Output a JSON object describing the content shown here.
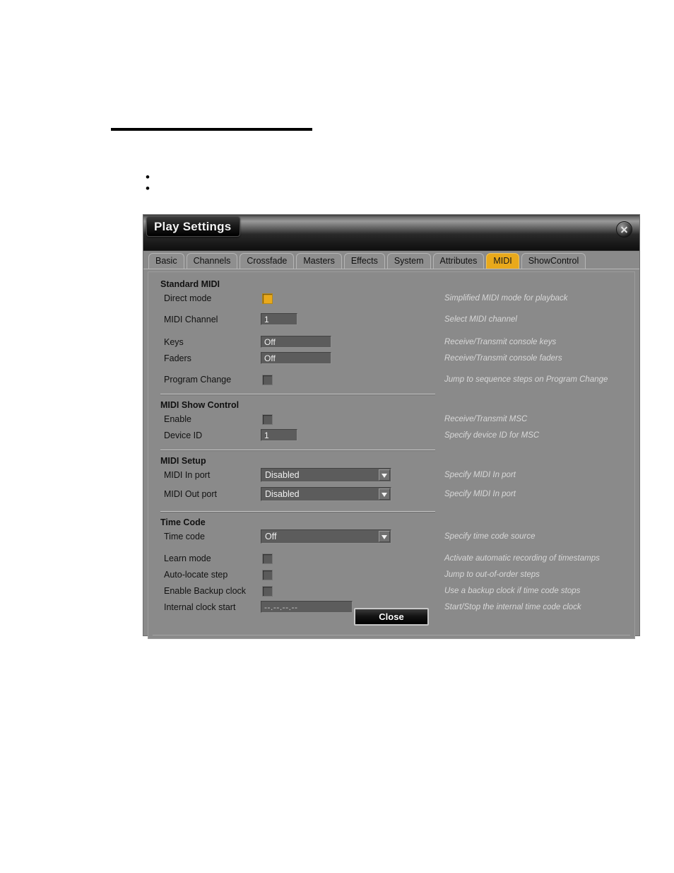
{
  "document": {
    "bullets": [
      "•",
      "•"
    ]
  },
  "dialog": {
    "title": "Play Settings",
    "close_icon": "close-circle-icon",
    "tabs": [
      {
        "label": "Basic",
        "active": false
      },
      {
        "label": "Channels",
        "active": false
      },
      {
        "label": "Crossfade",
        "active": false
      },
      {
        "label": "Masters",
        "active": false
      },
      {
        "label": "Effects",
        "active": false
      },
      {
        "label": "System",
        "active": false
      },
      {
        "label": "Attributes",
        "active": false
      },
      {
        "label": "MIDI",
        "active": true
      },
      {
        "label": "ShowControl",
        "active": false
      }
    ],
    "sections": {
      "standard_midi": {
        "title": "Standard MIDI",
        "rows": {
          "direct_mode": {
            "label": "Direct mode",
            "value": "on",
            "desc": "Simplified MIDI mode for playback"
          },
          "midi_channel": {
            "label": "MIDI Channel",
            "value": "1",
            "desc": "Select MIDI channel"
          },
          "keys": {
            "label": "Keys",
            "value": "Off",
            "desc": "Receive/Transmit console keys"
          },
          "faders": {
            "label": "Faders",
            "value": "Off",
            "desc": "Receive/Transmit console faders"
          },
          "program_change": {
            "label": "Program Change",
            "value": "off",
            "desc": "Jump to sequence steps on Program Change"
          }
        }
      },
      "midi_show_control": {
        "title": "MIDI Show Control",
        "rows": {
          "enable": {
            "label": "Enable",
            "value": "off",
            "desc": "Receive/Transmit MSC"
          },
          "device_id": {
            "label": "Device ID",
            "value": "1",
            "desc": "Specify device ID for MSC"
          }
        }
      },
      "midi_setup": {
        "title": "MIDI Setup",
        "rows": {
          "midi_in_port": {
            "label": "MIDI In port",
            "value": "Disabled",
            "desc": "Specify MIDI In port"
          },
          "midi_out_port": {
            "label": "MIDI Out port",
            "value": "Disabled",
            "desc": "Specify MIDI In port"
          }
        }
      },
      "time_code": {
        "title": "Time Code",
        "rows": {
          "time_code": {
            "label": "Time code",
            "value": "Off",
            "desc": "Specify time code source"
          },
          "learn_mode": {
            "label": "Learn mode",
            "value": "off",
            "desc": "Activate automatic recording of timestamps"
          },
          "auto_locate_step": {
            "label": "Auto-locate step",
            "value": "off",
            "desc": "Jump to out-of-order steps"
          },
          "enable_backup_clock": {
            "label": "Enable Backup clock",
            "value": "off",
            "desc": "Use a backup clock if time code stops"
          },
          "internal_clock_start": {
            "label": "Internal clock start",
            "value": "--.--.--.--",
            "desc": "Start/Stop the internal time code clock"
          }
        }
      }
    },
    "footer": {
      "close_label": "Close"
    },
    "colors": {
      "accent": "#e9a91b",
      "dialog_bg": "#8a8a8a",
      "field_bg": "#5c5c5c",
      "desc_text": "#d8d8d8"
    }
  }
}
